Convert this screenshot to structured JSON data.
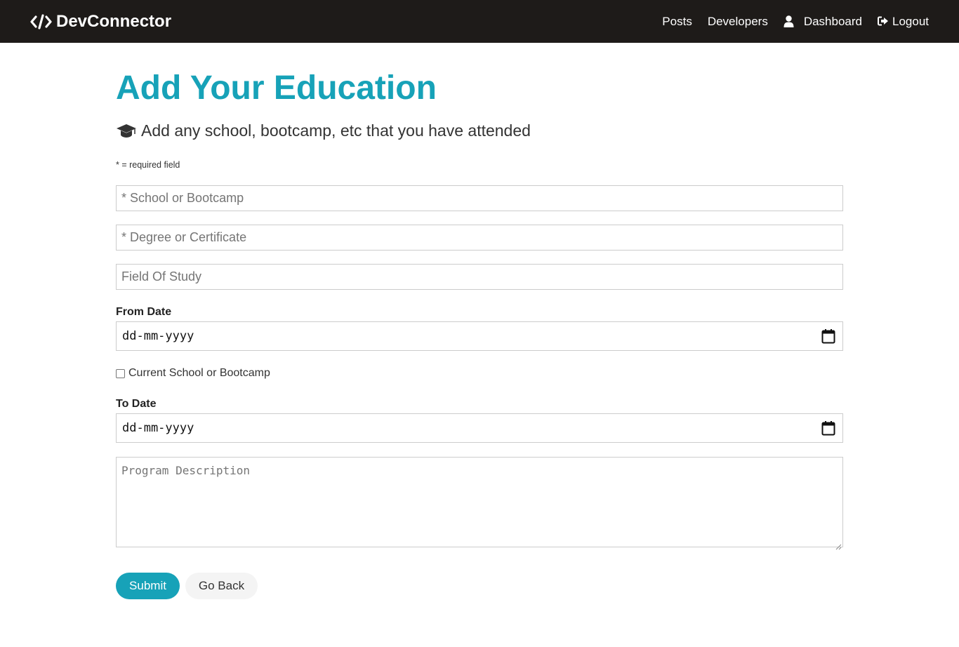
{
  "navbar": {
    "brand": "DevConnector",
    "links": {
      "posts": "Posts",
      "developers": "Developers",
      "dashboard": "Dashboard",
      "logout": "Logout"
    }
  },
  "page": {
    "title": "Add Your Education",
    "lead": "Add any school, bootcamp, etc that you have attended",
    "required_note": "* = required field"
  },
  "form": {
    "school_placeholder": "* School or Bootcamp",
    "degree_placeholder": "* Degree or Certificate",
    "field_placeholder": "Field Of Study",
    "from_label": "From Date",
    "from_value": "dd-mm-yyyy",
    "current_label": "Current School or Bootcamp",
    "current_checked": false,
    "to_label": "To Date",
    "to_value": "dd-mm-yyyy",
    "description_placeholder": "Program Description",
    "submit_label": "Submit",
    "back_label": "Go Back"
  },
  "colors": {
    "navbar_bg": "#1e1b19",
    "primary": "#17a2b8",
    "light": "#f4f4f4"
  }
}
